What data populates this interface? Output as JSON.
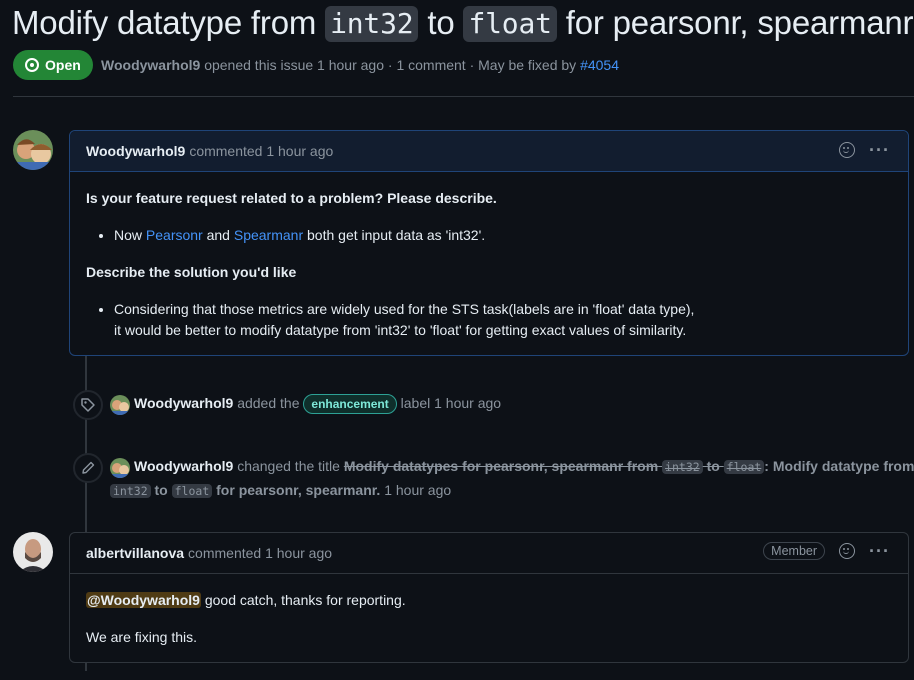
{
  "issue": {
    "title_pre": "Modify datatype from",
    "title_code1": "int32",
    "title_mid": "to",
    "title_code2": "float",
    "title_post": "for pearsonr, spearmanr.",
    "state": "Open",
    "author": "Woodywarhol9",
    "meta_text": "opened this issue 1 hour ago · 1 comment · May be fixed by",
    "fix_link": "#4054"
  },
  "comment1": {
    "author": "Woodywarhol9",
    "time": "commented 1 hour ago",
    "h1": "Is your feature request related to a problem? Please describe.",
    "li1_pre": "Now",
    "li1_link1": "Pearsonr",
    "li1_mid": "and",
    "li1_link2": "Spearmanr",
    "li1_post": "both get input data as 'int32'.",
    "h2": "Describe the solution you'd like",
    "li2_line1": "Considering that those metrics are widely used for the STS task(labels are in 'float' data type),",
    "li2_line2": "it would be better to modify datatype from 'int32' to 'float' for getting exact values of similarity."
  },
  "event_label": {
    "actor": "Woodywarhol9",
    "text1": "added the",
    "label": "enhancement",
    "text2": "label 1 hour ago",
    "label_color": "#2da195"
  },
  "event_rename": {
    "actor": "Woodywarhol9",
    "text1": "changed the title",
    "old_pre": "Modify datatypes for pearsonr, spearmanr from",
    "old_code1": "int32",
    "old_mid": "to",
    "old_code2": "float",
    "new_pre": "Modify datatype from",
    "new_code1": "int32",
    "new_mid": "to",
    "new_code2": "float",
    "new_post": "for pearsonr, spearmanr.",
    "time": "1 hour ago"
  },
  "comment2": {
    "author": "albertvillanova",
    "time": "commented 1 hour ago",
    "role": "Member",
    "mention": "@Woodywarhol9",
    "line1_post": "good catch, thanks for reporting.",
    "line2": "We are fixing this."
  },
  "icons": [
    "issue-open-icon",
    "smiley-icon",
    "kebab-icon",
    "tag-icon",
    "pencil-icon"
  ],
  "colors": {
    "open_green": "#238636",
    "link_blue": "#4493f8",
    "mention_bg": "#4f3b14"
  }
}
